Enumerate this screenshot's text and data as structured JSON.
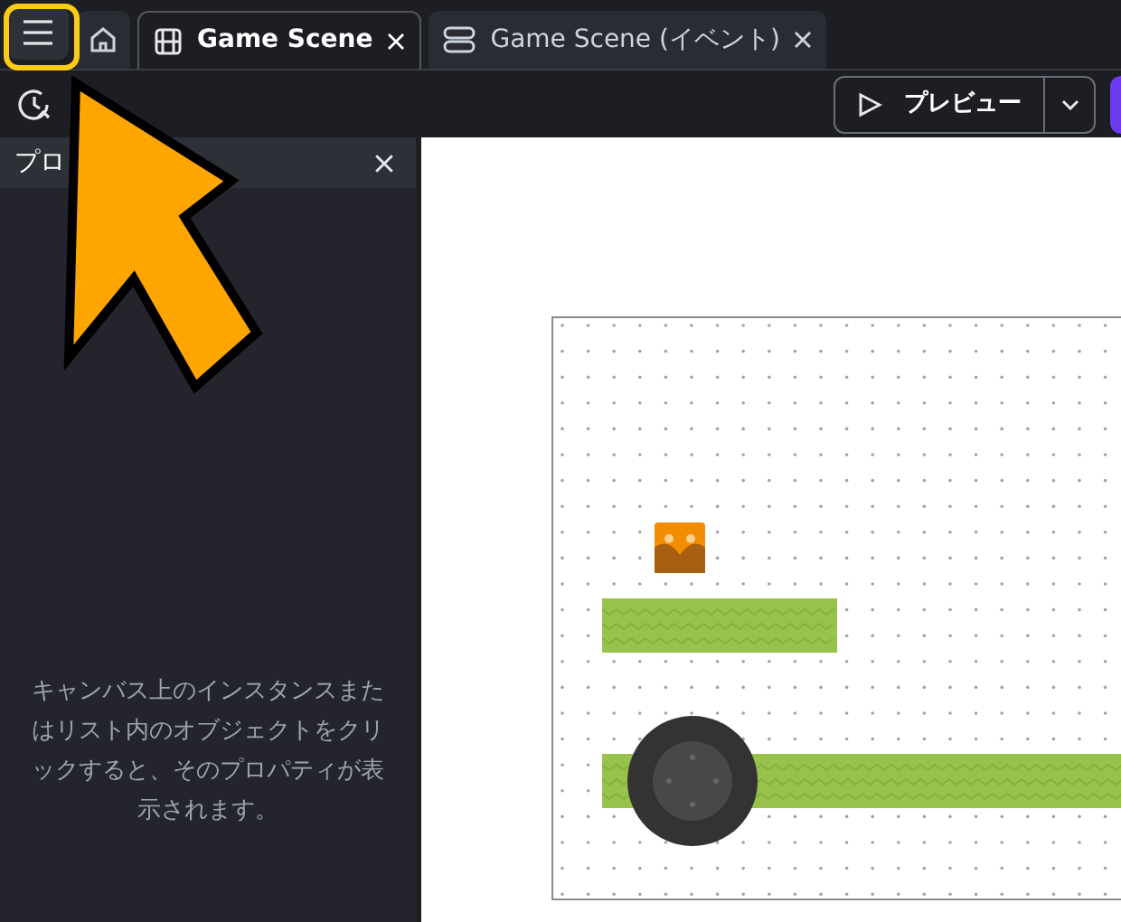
{
  "tabs": [
    {
      "kind": "scene",
      "label": "Game Scene",
      "selected": true
    },
    {
      "kind": "events",
      "label": "Game Scene (イベント)",
      "selected": false
    }
  ],
  "toolbar": {
    "preview_button": "プレビュー"
  },
  "properties_panel": {
    "title": "プロ",
    "hint": "キャンバス上のインスタンスまたはリスト内のオブジェクトをクリックすると、そのプロパティが表示されます。"
  },
  "annotation": {
    "highlight": true,
    "arrow": true
  }
}
